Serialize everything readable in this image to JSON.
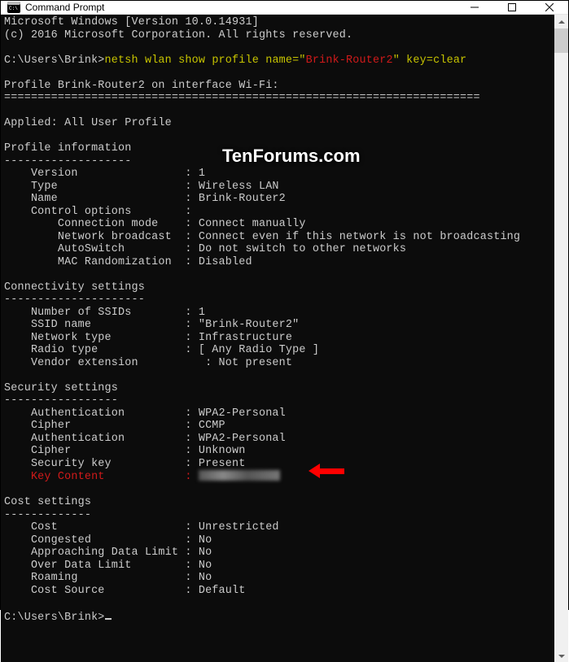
{
  "window": {
    "title": "Command Prompt"
  },
  "watermark": "TenForums.com",
  "header": {
    "line1": "Microsoft Windows [Version 10.0.14931]",
    "line2": "(c) 2016 Microsoft Corporation. All rights reserved."
  },
  "prompt1": {
    "path": "C:\\Users\\Brink>",
    "cmd_prefix": "netsh wlan show profile name=\"",
    "profile_name": "Brink-Router2",
    "cmd_suffix": "\" key=clear"
  },
  "profile_header": "Profile Brink-Router2 on interface Wi-Fi:",
  "divider": "=======================================================================",
  "applied": "Applied: All User Profile",
  "sections": {
    "profile_info": {
      "title": "Profile information",
      "dash": "-------------------",
      "rows": {
        "version": "    Version                : 1",
        "type": "    Type                   : Wireless LAN",
        "name": "    Name                   : Brink-Router2",
        "control": "    Control options        :",
        "conn_mode": "        Connection mode    : Connect manually",
        "broadcast": "        Network broadcast  : Connect even if this network is not broadcasting",
        "autoswitch": "        AutoSwitch         : Do not switch to other networks",
        "mac": "        MAC Randomization  : Disabled"
      }
    },
    "connectivity": {
      "title": "Connectivity settings",
      "dash": "---------------------",
      "rows": {
        "num_ssid": "    Number of SSIDs        : 1",
        "ssid": "    SSID name              : \"Brink-Router2\"",
        "net_type": "    Network type           : Infrastructure",
        "radio": "    Radio type             : [ Any Radio Type ]",
        "vendor": "    Vendor extension          : Not present"
      }
    },
    "security": {
      "title": "Security settings",
      "dash": "-----------------",
      "rows": {
        "auth1": "    Authentication         : WPA2-Personal",
        "cipher1": "    Cipher                 : CCMP",
        "auth2": "    Authentication         : WPA2-Personal",
        "cipher2": "    Cipher                 : Unknown",
        "seckey": "    Security key           : Present",
        "keycontent_label": "    Key Content            : "
      }
    },
    "cost": {
      "title": "Cost settings",
      "dash": "-------------",
      "rows": {
        "cost": "    Cost                   : Unrestricted",
        "congested": "    Congested              : No",
        "appr": "    Approaching Data Limit : No",
        "over": "    Over Data Limit        : No",
        "roaming": "    Roaming                : No",
        "source": "    Cost Source            : Default"
      }
    }
  },
  "prompt2": "C:\\Users\\Brink>"
}
